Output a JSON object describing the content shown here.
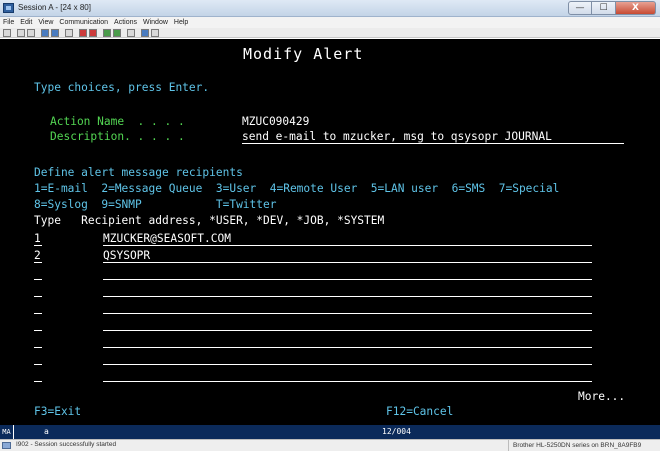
{
  "window": {
    "title": "Session A - [24 x 80]",
    "minimize": "—",
    "maximize": "☐",
    "close": "X"
  },
  "menu": [
    "File",
    "Edit",
    "View",
    "Communication",
    "Actions",
    "Window",
    "Help"
  ],
  "screen": {
    "title": "Modify Alert",
    "instruction": "Type choices, press Enter.",
    "action_name_label": "Action Name  . . . .",
    "action_name_value": "MZUC090429",
    "description_label": "Description. . . . .",
    "description_value": "send e-mail to mzucker, msg to qsysopr JOURNAL",
    "define_heading": "Define alert message recipients",
    "options_line1": "1=E-mail  2=Message Queue  3=User  4=Remote User  5=LAN user  6=SMS  7=Special",
    "options_line2": "8=Syslog  9=SNMP           T=Twitter",
    "column_header": "Type   Recipient address, *USER, *DEV, *JOB, *SYSTEM",
    "recipients": [
      {
        "type": "1",
        "address": "MZUCKER@SEASOFT.COM"
      },
      {
        "type": "2",
        "address": "QSYSOPR"
      },
      {
        "type": "",
        "address": ""
      },
      {
        "type": "",
        "address": ""
      },
      {
        "type": "",
        "address": ""
      },
      {
        "type": "",
        "address": ""
      },
      {
        "type": "",
        "address": ""
      },
      {
        "type": "",
        "address": ""
      },
      {
        "type": "",
        "address": ""
      }
    ],
    "more": "More...",
    "f3": "F3=Exit",
    "f12": "F12=Cancel"
  },
  "oia": {
    "mode": "MA",
    "indicator": "a",
    "cursor_pos": "12/004"
  },
  "status": {
    "message": "I902 - Session successfully started",
    "printer": "Brother HL-5250DN series on BRN_8A9FB9"
  },
  "colors": {
    "terminal_bg": "#000000",
    "cyan": "#5fc4e8",
    "white": "#ffffff",
    "pink": "#ff6ec7",
    "green": "#53d653"
  }
}
